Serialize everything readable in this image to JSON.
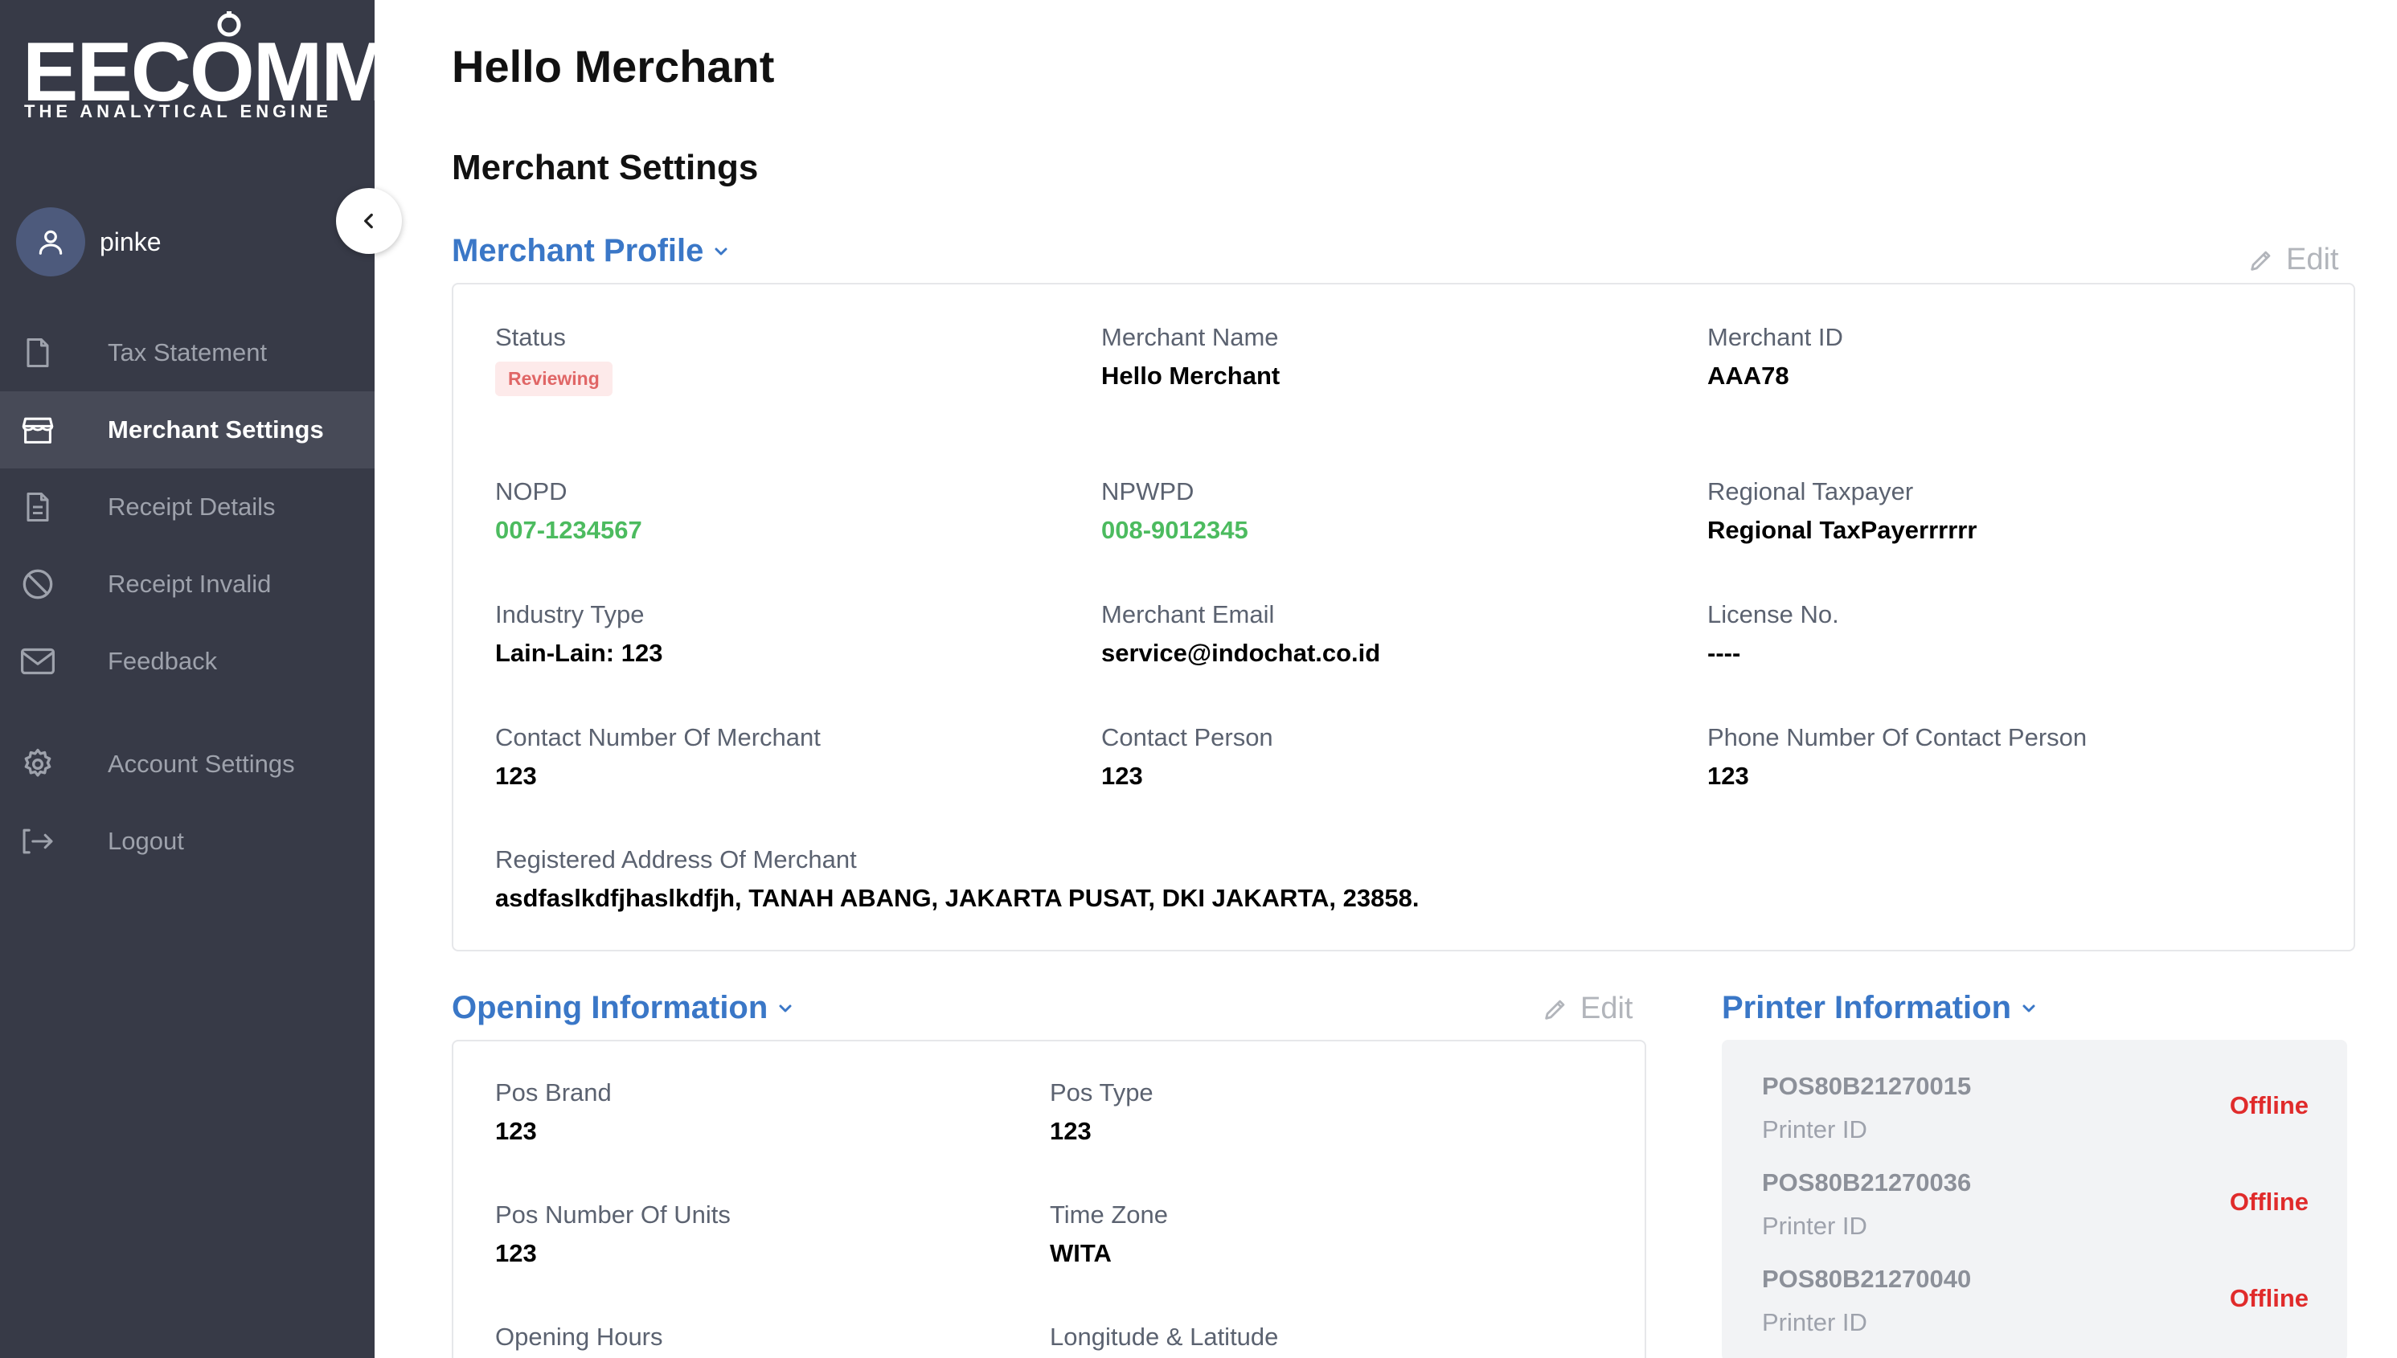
{
  "brand": {
    "name": "EECOMM",
    "tagline": "THE ANALYTICAL ENGINE"
  },
  "user": {
    "name": "pinke"
  },
  "sidebar": {
    "items": [
      {
        "label": "Tax Statement",
        "icon": "document-icon",
        "active": false
      },
      {
        "label": "Merchant Settings",
        "icon": "store-icon",
        "active": true
      },
      {
        "label": "Receipt Details",
        "icon": "receipt-icon",
        "active": false
      },
      {
        "label": "Receipt Invalid",
        "icon": "ban-icon",
        "active": false
      },
      {
        "label": "Feedback",
        "icon": "mail-icon",
        "active": false
      },
      {
        "label": "Account Settings",
        "icon": "gear-icon",
        "active": false
      },
      {
        "label": "Logout",
        "icon": "logout-icon",
        "active": false
      }
    ]
  },
  "page": {
    "title": "Hello Merchant",
    "section": "Merchant Settings"
  },
  "profile": {
    "title": "Merchant Profile",
    "edit": "Edit",
    "status": {
      "label": "Status",
      "value": "Reviewing"
    },
    "merchant_name": {
      "label": "Merchant Name",
      "value": "Hello Merchant"
    },
    "merchant_id": {
      "label": "Merchant ID",
      "value": "AAA78"
    },
    "nopd": {
      "label": "NOPD",
      "value": "007-1234567"
    },
    "npwpd": {
      "label": "NPWPD",
      "value": "008-9012345"
    },
    "regional_taxpayer": {
      "label": "Regional Taxpayer",
      "value": "Regional TaxPayerrrrrr"
    },
    "industry_type": {
      "label": "Industry Type",
      "value": "Lain-Lain: 123"
    },
    "merchant_email": {
      "label": "Merchant Email",
      "value": "service@indochat.co.id"
    },
    "license_no": {
      "label": "License No.",
      "value": "----"
    },
    "contact_number": {
      "label": "Contact Number Of Merchant",
      "value": "123"
    },
    "contact_person": {
      "label": "Contact Person",
      "value": "123"
    },
    "contact_phone": {
      "label": "Phone Number Of Contact Person",
      "value": "123"
    },
    "address": {
      "label": "Registered Address Of Merchant",
      "value": "asdfaslkdfjhaslkdfjh, TANAH ABANG, JAKARTA PUSAT, DKI JAKARTA, 23858."
    }
  },
  "opening": {
    "title": "Opening Information",
    "edit": "Edit",
    "pos_brand": {
      "label": "Pos Brand",
      "value": "123"
    },
    "pos_type": {
      "label": "Pos Type",
      "value": "123"
    },
    "pos_units": {
      "label": "Pos Number Of Units",
      "value": "123"
    },
    "time_zone": {
      "label": "Time Zone",
      "value": "WITA"
    },
    "opening_hours": {
      "label": "Opening Hours"
    },
    "lon_lat": {
      "label": "Longitude & Latitude"
    }
  },
  "printer": {
    "title": "Printer Information",
    "items": [
      {
        "id": "POS80B21270015",
        "label": "Printer ID",
        "status": "Offline"
      },
      {
        "id": "POS80B21270036",
        "label": "Printer ID",
        "status": "Offline"
      },
      {
        "id": "POS80B21270040",
        "label": "Printer ID",
        "status": "Offline"
      }
    ]
  },
  "colors": {
    "sidebar_bg": "#373a47",
    "accent": "#3a77c7",
    "green": "#4cbb5f",
    "offline": "#e02b2b",
    "badge_bg": "#fdeaea",
    "badge_text": "#e06666"
  }
}
